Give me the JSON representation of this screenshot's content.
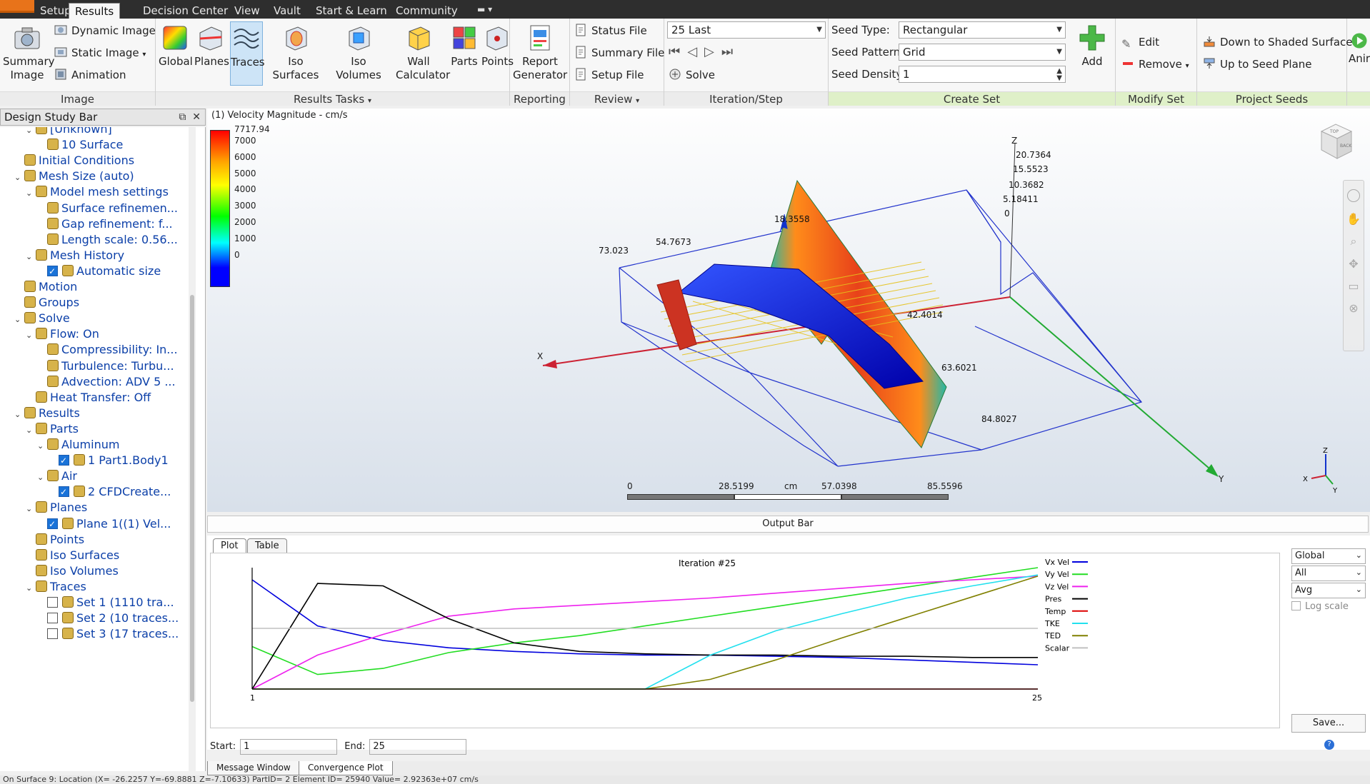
{
  "tabs": [
    "Setup",
    "Results",
    "Decision Center",
    "View",
    "Vault",
    "Start & Learn",
    "Community"
  ],
  "ribbon": {
    "image": {
      "summary_image": "Summary Image",
      "dynamic_image": "Dynamic Image",
      "static_image": "Static Image",
      "animation": "Animation",
      "label": "Image"
    },
    "results_tasks": {
      "buttons": [
        "Global",
        "Planes",
        "Traces",
        "Iso Surfaces",
        "Iso Volumes",
        "Wall Calculator",
        "Parts",
        "Points"
      ],
      "label": "Results Tasks"
    },
    "reporting": {
      "report_generator": "Report Generator",
      "label": "Reporting"
    },
    "review": {
      "status_file": "Status File",
      "summary_file": "Summary File",
      "setup_file": "Setup File",
      "label": "Review"
    },
    "iteration": {
      "selection": "25 Last",
      "solve": "Solve",
      "label": "Iteration/Step"
    },
    "create_set": {
      "seed_type_label": "Seed Type:",
      "seed_type": "Rectangular",
      "seed_pattern_label": "Seed Pattern:",
      "seed_pattern": "Grid",
      "seed_density_label": "Seed Density:",
      "seed_density": "1",
      "add": "Add",
      "label": "Create Set"
    },
    "modify_set": {
      "edit": "Edit",
      "remove": "Remove",
      "label": "Modify Set"
    },
    "project_seeds": {
      "down": "Down to Shaded Surface",
      "up": "Up to Seed Plane",
      "label": "Project Seeds"
    },
    "extra": "Anir"
  },
  "design_study_bar": {
    "title": "Design Study Bar",
    "nodes": [
      {
        "label": "[Unknown]",
        "level": 2,
        "exp": "v"
      },
      {
        "label": "10 Surface",
        "level": 3,
        "exp": ""
      },
      {
        "label": "Initial Conditions",
        "level": 1,
        "exp": ""
      },
      {
        "label": "Mesh Size (auto)",
        "level": 1,
        "exp": "v"
      },
      {
        "label": "Model mesh settings",
        "level": 2,
        "exp": "v"
      },
      {
        "label": "Surface refinemen...",
        "level": 3,
        "exp": ""
      },
      {
        "label": "Gap refinement: f...",
        "level": 3,
        "exp": ""
      },
      {
        "label": "Length scale: 0.56...",
        "level": 3,
        "exp": ""
      },
      {
        "label": "Mesh History",
        "level": 2,
        "exp": "v"
      },
      {
        "label": "Automatic size",
        "level": 3,
        "exp": "",
        "check": true
      },
      {
        "label": "Motion",
        "level": 1,
        "exp": ""
      },
      {
        "label": "Groups",
        "level": 1,
        "exp": ""
      },
      {
        "label": "Solve",
        "level": 1,
        "exp": "v"
      },
      {
        "label": "Flow: On",
        "level": 2,
        "exp": "v"
      },
      {
        "label": "Compressibility: In...",
        "level": 3,
        "exp": ""
      },
      {
        "label": "Turbulence: Turbu...",
        "level": 3,
        "exp": ""
      },
      {
        "label": "Advection: ADV 5 ...",
        "level": 3,
        "exp": ""
      },
      {
        "label": "Heat Transfer: Off",
        "level": 2,
        "exp": ""
      },
      {
        "label": "Results",
        "level": 1,
        "exp": "v"
      },
      {
        "label": "Parts",
        "level": 2,
        "exp": "v"
      },
      {
        "label": "Aluminum",
        "level": 3,
        "exp": "v"
      },
      {
        "label": "1 Part1.Body1",
        "level": 4,
        "exp": "",
        "check": true
      },
      {
        "label": "Air",
        "level": 3,
        "exp": "v"
      },
      {
        "label": "2 CFDCreate...",
        "level": 4,
        "exp": "",
        "check": true
      },
      {
        "label": "Planes",
        "level": 2,
        "exp": "v"
      },
      {
        "label": "Plane 1((1) Vel...",
        "level": 3,
        "exp": "",
        "check": true
      },
      {
        "label": "Points",
        "level": 2,
        "exp": ""
      },
      {
        "label": "Iso Surfaces",
        "level": 2,
        "exp": ""
      },
      {
        "label": "Iso Volumes",
        "level": 2,
        "exp": ""
      },
      {
        "label": "Traces",
        "level": 2,
        "exp": "v"
      },
      {
        "label": "Set 1 (1110 tra...",
        "level": 3,
        "exp": "",
        "check": false
      },
      {
        "label": "Set 2 (10 traces...",
        "level": 3,
        "exp": "",
        "check": false
      },
      {
        "label": "Set 3 (17 traces...",
        "level": 3,
        "exp": "",
        "check": false
      }
    ]
  },
  "viewport": {
    "title": "(1) Velocity Magnitude - cm/s",
    "legend_max": "7717.94",
    "legend_ticks": [
      "7000",
      "6000",
      "5000",
      "4000",
      "3000",
      "2000",
      "1000",
      "0"
    ],
    "axis_labels": {
      "x": "X",
      "y": "Y",
      "z": "Z"
    },
    "dims": [
      "20.7364",
      "15.5523",
      "10.3682",
      "5.18411",
      "0",
      "18.3558",
      "54.7673",
      "73.023",
      "42.4014",
      "63.6021",
      "84.8027"
    ],
    "scale": [
      "0",
      "28.5199",
      "cm",
      "57.0398",
      "85.5596"
    ],
    "viewcube_top": "TOP",
    "viewcube_back": "BACK"
  },
  "output_bar": {
    "title": "Output Bar",
    "tabs": [
      "Plot",
      "Table"
    ],
    "plot_title": "Iteration #25",
    "x_start_label": "1",
    "x_end_label": "25",
    "start_label": "Start:",
    "start_value": "1",
    "end_label": "End:",
    "end_value": "25",
    "options": [
      "Global",
      "All",
      "Avg"
    ],
    "log_scale": "Log scale",
    "save": "Save...",
    "bottom_tabs": [
      "Message Window",
      "Convergence Plot"
    ]
  },
  "chart_data": {
    "type": "line",
    "title": "Iteration #25",
    "x": [
      1,
      3,
      5,
      7,
      9,
      11,
      13,
      15,
      17,
      19,
      21,
      23,
      25
    ],
    "xlim": [
      1,
      25
    ],
    "ylim": [
      0,
      100
    ],
    "series": [
      {
        "name": "Vx Vel",
        "color": "#0000dd",
        "values": [
          90,
          52,
          40,
          34,
          31,
          29,
          28,
          28,
          27,
          26,
          24,
          22,
          20
        ]
      },
      {
        "name": "Vy Vel",
        "color": "#22dd22",
        "values": [
          35,
          12,
          17,
          30,
          38,
          44,
          52,
          60,
          68,
          76,
          84,
          92,
          100
        ]
      },
      {
        "name": "Vz Vel",
        "color": "#ee22ee",
        "values": [
          0,
          28,
          45,
          60,
          66,
          69,
          72,
          75,
          79,
          83,
          87,
          90,
          93
        ]
      },
      {
        "name": "Pres",
        "color": "#000000",
        "values": [
          0,
          87,
          85,
          58,
          38,
          31,
          29,
          28,
          28,
          27,
          27,
          26,
          26
        ]
      },
      {
        "name": "Temp",
        "color": "#dd0000",
        "values": [
          0,
          0,
          0,
          0,
          0,
          0,
          0,
          0,
          0,
          0,
          0,
          0,
          0
        ]
      },
      {
        "name": "TKE",
        "color": "#22e0ee",
        "values": [
          0,
          0,
          0,
          0,
          0,
          0,
          0,
          28,
          48,
          62,
          75,
          85,
          94
        ]
      },
      {
        "name": "TED",
        "color": "#808000",
        "values": [
          0,
          0,
          0,
          0,
          0,
          0,
          0,
          8,
          24,
          42,
          59,
          76,
          93
        ]
      },
      {
        "name": "Scalar",
        "color": "#c0c0c0",
        "values": [
          50,
          50,
          50,
          50,
          50,
          50,
          50,
          50,
          50,
          50,
          50,
          50,
          50
        ]
      }
    ]
  },
  "status": "On Surface 9: Location (X= -26.2257 Y=-69.8881 Z=-7.10633) PartID= 2 Element ID= 25940  Value= 2.92363e+07 cm/s"
}
